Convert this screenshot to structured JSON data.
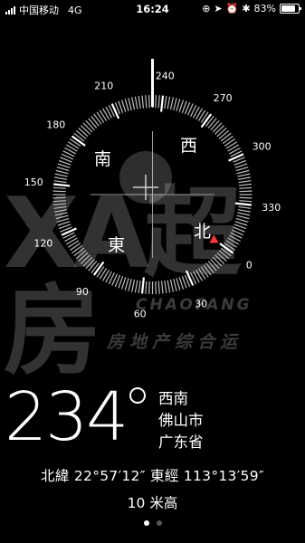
{
  "status_bar": {
    "carrier": "中国移动",
    "network": "4G",
    "time": "16:24",
    "battery_percent": "83%",
    "battery_level": 0.83,
    "icons": [
      "orientation-lock-icon",
      "location-arrow-icon",
      "alarm-icon",
      "bluetooth-icon"
    ]
  },
  "compass": {
    "heading_value": 234,
    "degree_labels": [
      "0",
      "30",
      "60",
      "90",
      "120",
      "150",
      "180",
      "210",
      "240",
      "270",
      "300",
      "330"
    ],
    "cardinals": {
      "north": "北",
      "east": "東",
      "south": "南",
      "west": "西"
    },
    "target_marker_color": "#ff3b30"
  },
  "watermark": {
    "big_text": "XA超房",
    "brand_latin": "CHAOFANG",
    "slogan": "房地产综合运"
  },
  "readout": {
    "heading": "234",
    "direction": "西南",
    "city": "佛山市",
    "province": "广东省",
    "coordinates": "北緯 22°57′12″ 東經 113°13′59″",
    "altitude": "10 米高"
  },
  "pagination": {
    "pages": 2,
    "current": 1
  }
}
